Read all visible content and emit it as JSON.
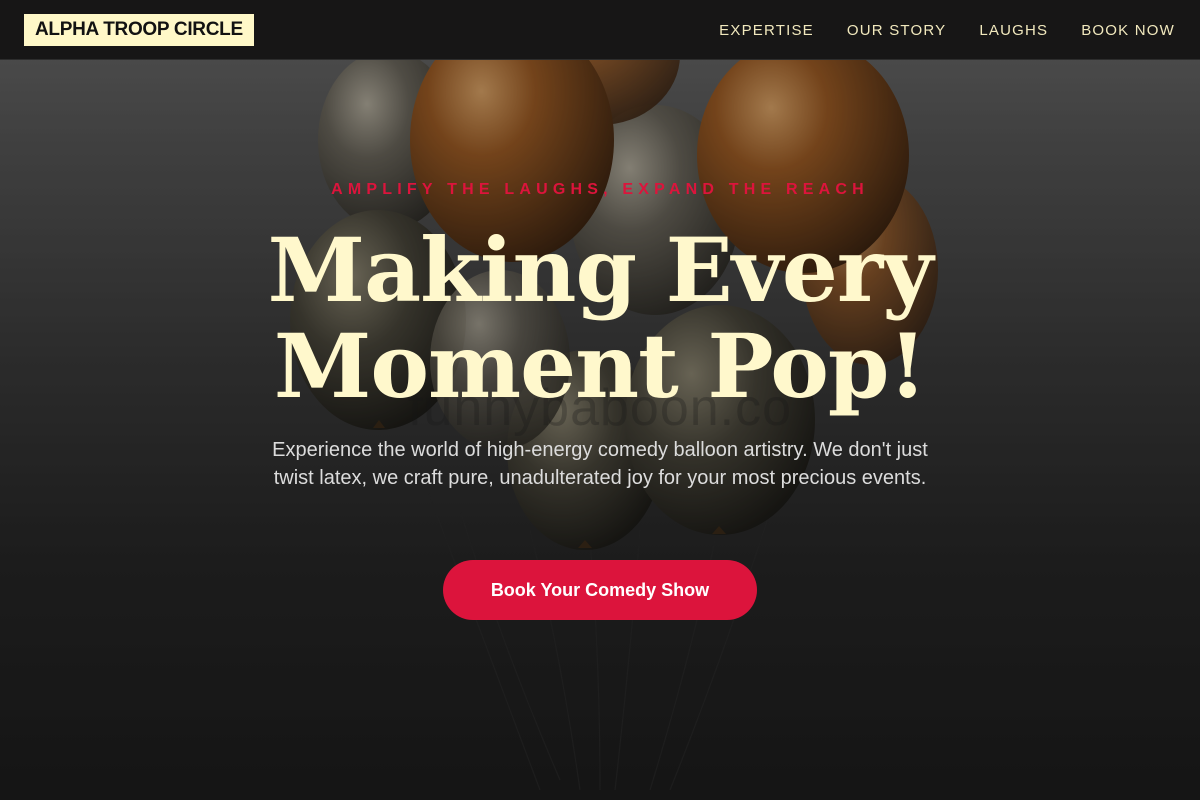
{
  "brand": {
    "logo_text": "ALPHA TROOP CIRCLE"
  },
  "nav": {
    "links": [
      {
        "label": "EXPERTISE"
      },
      {
        "label": "OUR STORY"
      },
      {
        "label": "LAUGHS"
      },
      {
        "label": "BOOK NOW"
      }
    ]
  },
  "hero": {
    "tagline": "AMPLIFY THE LAUGHS, EXPAND THE REACH",
    "headline_line1": "Making Every",
    "headline_line2": "Moment Pop!",
    "description": "Experience the world of high-energy comedy balloon artistry. We don't just twist latex, we craft pure, unadulterated joy for your most precious events.",
    "watermark": "funnybaboon.co",
    "cta_label": "Book Your Comedy Show",
    "background_image": "metallic-balloon-bunch"
  },
  "colors": {
    "accent": "#dc143c",
    "headline": "#fff8cc",
    "logo_bg": "#fff8c8",
    "nav_bg": "#171616",
    "nav_text": "#f1e8bd"
  }
}
